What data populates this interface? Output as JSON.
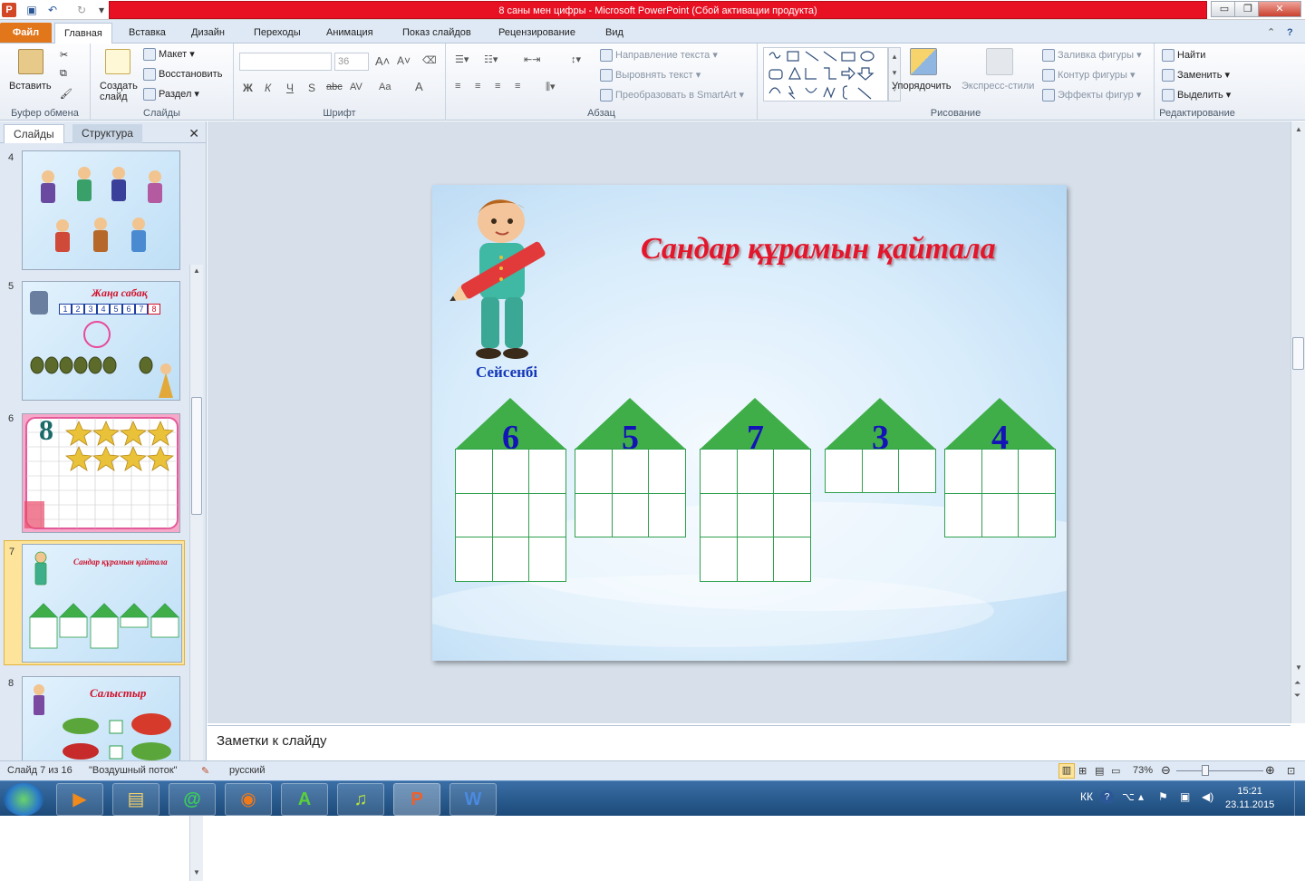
{
  "window": {
    "title": "8 саны мен цифры - Microsoft PowerPoint (Сбой активации продукта)",
    "minimize": "▭",
    "restore": "❐",
    "close": "✕"
  },
  "qat": {
    "save_icon": "save-icon",
    "undo_icon": "undo-icon",
    "redo_icon": "redo-icon"
  },
  "tabs": [
    "Файл",
    "Главная",
    "Вставка",
    "Дизайн",
    "Переходы",
    "Анимация",
    "Показ слайдов",
    "Рецензирование",
    "Вид"
  ],
  "ribbon": {
    "clipboard": {
      "paste": "Вставить",
      "label": "Буфер обмена"
    },
    "slides": {
      "new_slide": "Создать слайд",
      "layout": "Макет",
      "reset": "Восстановить",
      "section": "Раздел",
      "label": "Слайды"
    },
    "font": {
      "size": "36",
      "label": "Шрифт",
      "bold": "Ж",
      "italic": "К",
      "underline": "Ч",
      "shadow": "S",
      "strike": "abc",
      "spacing": "AV",
      "case": "Aa",
      "color": "A"
    },
    "paragraph": {
      "direction": "Направление текста",
      "align": "Выровнять текст",
      "smartart": "Преобразовать в SmartArt",
      "label": "Абзац"
    },
    "drawing": {
      "arrange": "Упорядочить",
      "quick_styles": "Экспресс-стили",
      "fill": "Заливка фигуры",
      "outline": "Контур фигуры",
      "effects": "Эффекты фигур",
      "label": "Рисование"
    },
    "editing": {
      "find": "Найти",
      "replace": "Заменить",
      "select": "Выделить",
      "label": "Редактирование"
    }
  },
  "panel": {
    "tab_slides": "Слайды",
    "tab_outline": "Структура",
    "close": "✕",
    "thumbnails": [
      {
        "num": "4"
      },
      {
        "num": "5",
        "title": "Жаңа сабақ",
        "digits": [
          "1",
          "2",
          "3",
          "4",
          "5",
          "6",
          "7",
          "8"
        ]
      },
      {
        "num": "6",
        "digit": "8"
      },
      {
        "num": "7",
        "title": "Сандар құрамын қайтала"
      },
      {
        "num": "8",
        "title": "Салыстыр"
      }
    ]
  },
  "slide": {
    "title": "Сандар құрамын қайтала",
    "name": "Сейсенбі",
    "houses": [
      {
        "number": "6",
        "rows": 3
      },
      {
        "number": "5",
        "rows": 2
      },
      {
        "number": "7",
        "rows": 3
      },
      {
        "number": "3",
        "rows": 1
      },
      {
        "number": "4",
        "rows": 2
      }
    ]
  },
  "notes": {
    "placeholder": "Заметки к слайду"
  },
  "status": {
    "slide": "Слайд 7 из 16",
    "theme": "\"Воздушный поток\"",
    "language": "русский",
    "zoom": "73%"
  },
  "taskbar": {
    "lang": "КК",
    "time": "15:21",
    "date": "23.11.2015"
  },
  "colors": {
    "title_red": "#e3162b",
    "house_green": "#3fae49",
    "number_blue": "#1313b8",
    "name_blue": "#1438b8",
    "file_tab": "#e1761b",
    "title_bar": "#e81123"
  }
}
